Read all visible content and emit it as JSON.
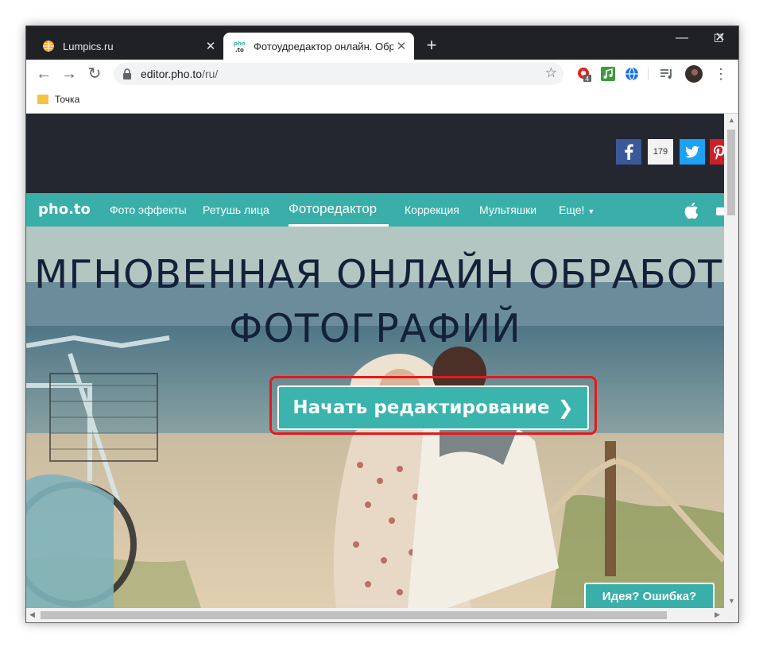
{
  "browser": {
    "tabs": [
      {
        "title": "Lumpics.ru",
        "icon": "orange-globe-icon",
        "active": false
      },
      {
        "title": "Фотоудредактор онлайн. Обрезать",
        "icon": "photo-to-icon",
        "active": true
      }
    ],
    "new_tab": "+",
    "window_controls": {
      "minimize": "—",
      "maximize": "☐",
      "close": "✕"
    },
    "address": {
      "host": "editor.pho.to",
      "path": "/ru/"
    },
    "extensions": {
      "badge_count": "4"
    },
    "bookmark": {
      "label": "Точка"
    }
  },
  "site": {
    "share": {
      "count": "179"
    },
    "logo": "pho.to",
    "nav": [
      {
        "label": "Фото эффекты"
      },
      {
        "label": "Ретушь лица"
      },
      {
        "label": "Фоторедактор"
      },
      {
        "label": "Коррекция"
      },
      {
        "label": "Мультяшки"
      },
      {
        "label": "Еще!"
      }
    ],
    "hero": {
      "title_line1": "МГНОВЕННАЯ ОНЛАЙН ОБРАБОТКА",
      "title_line2": "ФОТОГРАФИЙ",
      "cta_label": "Начать редактирование",
      "feedback": "Идея? Ошибка?"
    }
  },
  "colors": {
    "accent": "#3aafa9",
    "header_dark": "#24272f",
    "highlight": "#e51919",
    "hero_text": "#14213a"
  }
}
